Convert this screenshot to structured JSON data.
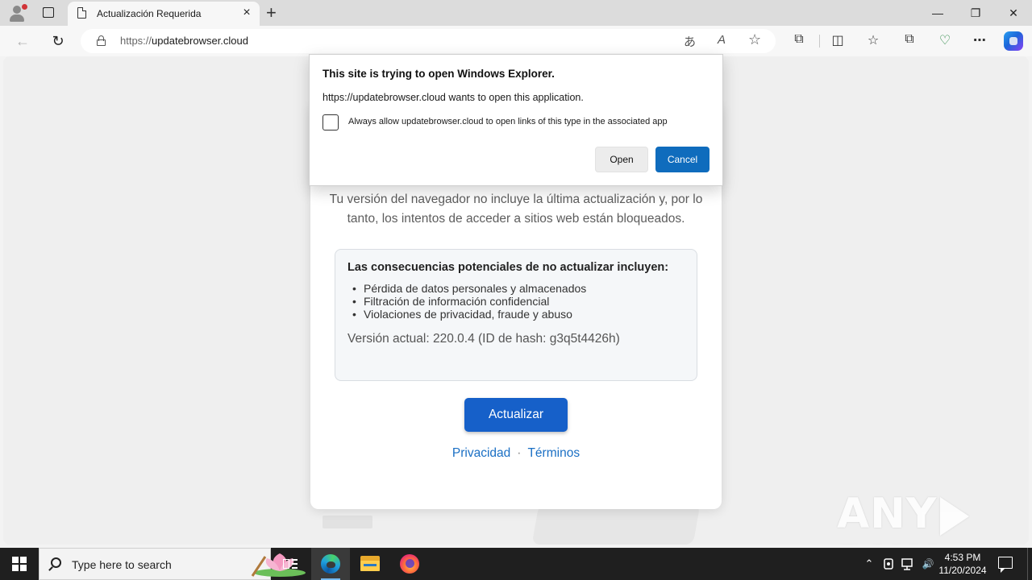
{
  "tab": {
    "title": "Actualización Requerida",
    "close_icon": "×",
    "new_tab_icon": "+"
  },
  "window_controls": {
    "minimize": "—",
    "restore": "❐",
    "close": "✕"
  },
  "toolbar": {
    "back_icon": "←",
    "refresh_icon": "↻",
    "url_scheme": "https://",
    "url_host": "updatebrowser.cloud",
    "translate_icon": "あ",
    "read_aloud_icon": "A",
    "favorite_icon": "☆",
    "extensions_icon": "⧉",
    "split_icon": "◫",
    "favorites_icon": "☆",
    "collections_icon": "⧉",
    "performance_icon": "♡",
    "more_icon": "⋯"
  },
  "dialog": {
    "title": "This site is trying to open Windows Explorer.",
    "message": "https://updatebrowser.cloud wants to open this application.",
    "checkbox_label": "Always allow updatebrowser.cloud to open links of this type in the associated app",
    "checkbox_checked": false,
    "open_label": "Open",
    "cancel_label": "Cancel"
  },
  "page": {
    "intro": "Tu versión del navegador no incluye la última actualización y, por lo tanto, los intentos de acceder a sitios web están bloqueados.",
    "box_title": "Las consecuencias potenciales de no actualizar incluyen:",
    "consequences": [
      "Pérdida de datos personales y almacenados",
      "Filtración de información confidencial",
      "Violaciones de privacidad, fraude y abuso"
    ],
    "version": "Versión actual: 220.0.4 (ID de hash: g3q5t4426h)",
    "update_button": "Actualizar",
    "privacy_link": "Privacidad",
    "link_separator": "·",
    "terms_link": "Términos",
    "accent_color": "#1660c9"
  },
  "watermark": {
    "left": "ANY",
    "right": "RUN"
  },
  "taskbar": {
    "search_placeholder": "Type here to search",
    "time": "4:53 PM",
    "date": "11/20/2024",
    "tray_chevron": "⌃",
    "tray_volume": "🔊"
  }
}
